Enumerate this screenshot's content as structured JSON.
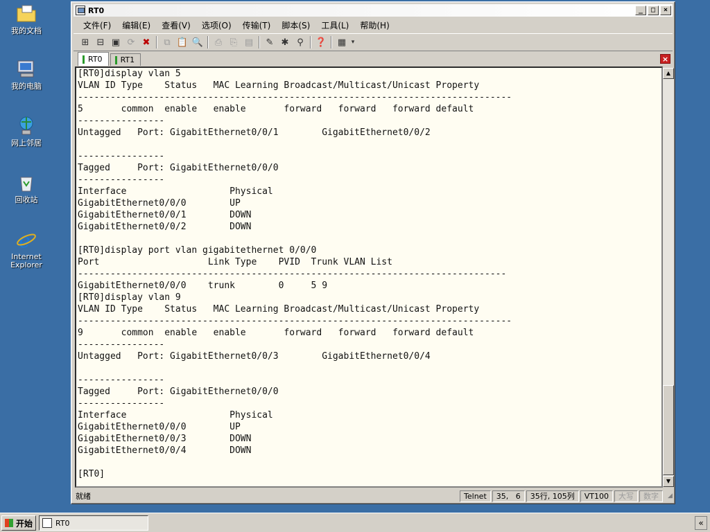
{
  "desktop": {
    "icons": [
      {
        "label": "我的文档",
        "icon": "folder-documents-icon"
      },
      {
        "label": "我的电脑",
        "icon": "computer-icon"
      },
      {
        "label": "网上邻居",
        "icon": "network-icon"
      },
      {
        "label": "回收站",
        "icon": "recycle-bin-icon"
      },
      {
        "label_line1": "Internet",
        "label_line2": "Explorer",
        "icon": "ie-icon"
      }
    ]
  },
  "window": {
    "title": "RT0",
    "menu": [
      "文件(F)",
      "编辑(E)",
      "查看(V)",
      "选项(O)",
      "传输(T)",
      "脚本(S)",
      "工具(L)",
      "帮助(H)"
    ],
    "tabs": [
      {
        "label": "RT0",
        "active": true
      },
      {
        "label": "RT1",
        "active": false
      }
    ]
  },
  "terminal": {
    "lines": [
      "[RT0]display vlan 5",
      "VLAN ID Type    Status   MAC Learning Broadcast/Multicast/Unicast Property",
      "--------------------------------------------------------------------------------",
      "5       common  enable   enable       forward   forward   forward default",
      "----------------",
      "Untagged   Port: GigabitEthernet0/0/1        GigabitEthernet0/0/2",
      "",
      "----------------",
      "Tagged     Port: GigabitEthernet0/0/0",
      "----------------",
      "Interface                   Physical",
      "GigabitEthernet0/0/0        UP",
      "GigabitEthernet0/0/1        DOWN",
      "GigabitEthernet0/0/2        DOWN",
      "",
      "[RT0]display port vlan gigabitethernet 0/0/0",
      "Port                    Link Type    PVID  Trunk VLAN List",
      "-------------------------------------------------------------------------------",
      "GigabitEthernet0/0/0    trunk        0     5 9",
      "[RT0]display vlan 9",
      "VLAN ID Type    Status   MAC Learning Broadcast/Multicast/Unicast Property",
      "--------------------------------------------------------------------------------",
      "9       common  enable   enable       forward   forward   forward default",
      "----------------",
      "Untagged   Port: GigabitEthernet0/0/3        GigabitEthernet0/0/4",
      "",
      "----------------",
      "Tagged     Port: GigabitEthernet0/0/0",
      "----------------",
      "Interface                   Physical",
      "GigabitEthernet0/0/0        UP",
      "GigabitEthernet0/0/3        DOWN",
      "GigabitEthernet0/0/4        DOWN",
      "",
      "[RT0]"
    ]
  },
  "statusbar": {
    "ready": "就绪",
    "protocol": "Telnet",
    "cursor": "35,   6",
    "size": "35行, 105列",
    "terminal_type": "VT100",
    "caps": "大写",
    "num": "数字"
  },
  "taskbar": {
    "start": "开始",
    "task_label": "RT0",
    "tray_toggle": "«"
  }
}
